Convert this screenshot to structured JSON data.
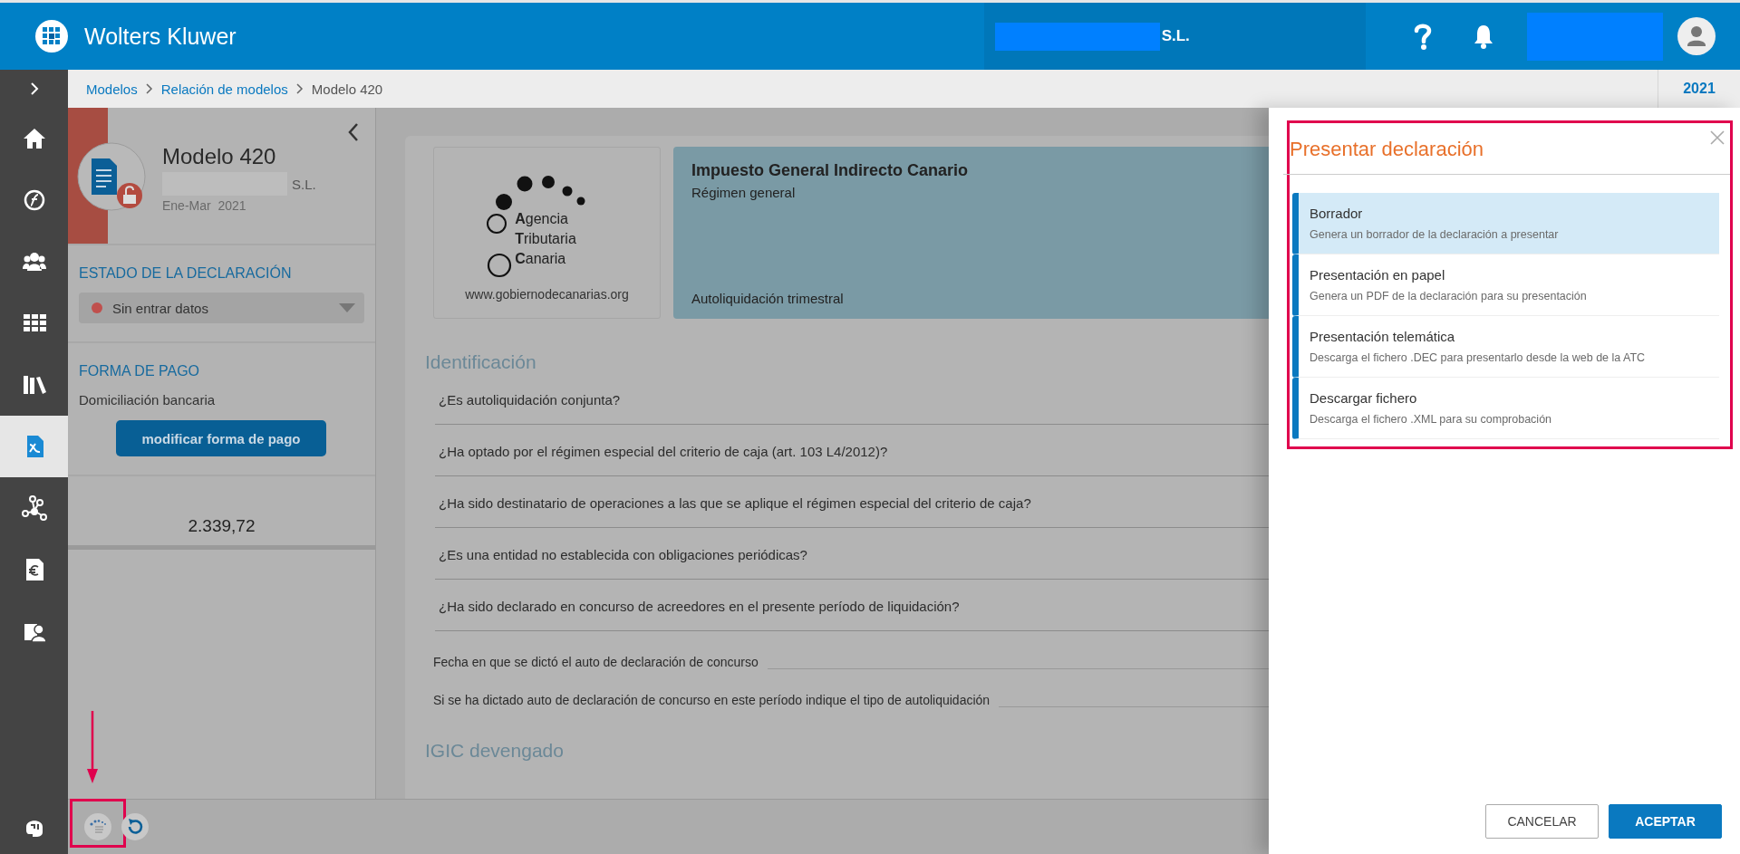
{
  "header": {
    "brand": "Wolters Kluwer",
    "company_suffix": "S.L."
  },
  "breadcrumbs": [
    {
      "label": "Modelos",
      "link": true
    },
    {
      "label": "Relación de modelos",
      "link": true
    },
    {
      "label": "Modelo 420",
      "link": false
    }
  ],
  "year": "2021",
  "nav": {
    "items": [
      {
        "kind": "home",
        "selected": false
      },
      {
        "kind": "formula",
        "selected": false
      },
      {
        "kind": "people",
        "selected": false
      },
      {
        "kind": "grid",
        "selected": false
      },
      {
        "kind": "books",
        "selected": false
      },
      {
        "kind": "document",
        "selected": true
      },
      {
        "kind": "network",
        "selected": false
      },
      {
        "kind": "euro",
        "selected": false
      },
      {
        "kind": "contact",
        "selected": false
      }
    ],
    "footer": {
      "kind": "support",
      "selected": false
    }
  },
  "model_panel": {
    "title": "Modelo 420",
    "company_suffix": "S.L.",
    "period": "Ene-Mar  2021",
    "status_heading": "ESTADO DE LA DECLARACIÓN",
    "status": {
      "label": "Sin entrar datos",
      "color": "#c0504d"
    },
    "payment_heading": "FORMA DE PAGO",
    "payment_method": "Domiciliación bancaria",
    "payment_button": "modificar forma de pago",
    "total": "2.339,72"
  },
  "summary": {
    "agency_lines": [
      "**A**gencia",
      "**T**ributaria",
      "**C**anaria"
    ],
    "agency_url": "www.gobiernodecanarias.org",
    "tax_title": "Impuesto General Indirecto Canario",
    "regime": "Régimen general",
    "period_type": "Autoliquidación trimestral"
  },
  "sections": [
    {
      "title": "Identificación",
      "questions": [
        "¿Es autoliquidación conjunta?",
        "¿Ha optado por el régimen especial del criterio de caja (art. 103 L4/2012)?",
        "¿Ha sido destinatario de operaciones a las que se aplique el régimen especial del criterio de caja?",
        "¿Es una entidad no establecida con obligaciones periódicas?",
        "¿Ha sido declarado en concurso de acreedores en el presente período de liquidación?"
      ],
      "fields": [
        {
          "label": "Fecha en que se dictó el auto de declaración de concurso"
        },
        {
          "label": "Si se ha dictado auto de declaración de concurso en este período indique el tipo de autoliquidación"
        }
      ]
    },
    {
      "title": "IGIC devengado"
    }
  ],
  "bottom_toolbar": [
    {
      "kind": "agency",
      "highlighted": true
    },
    {
      "kind": "refresh",
      "highlighted": false
    }
  ],
  "dialog": {
    "title": "Presentar declaración",
    "highlighted": true,
    "options": [
      {
        "title": "Borrador",
        "description": "Genera un borrador de la declaración a presentar",
        "selected": true
      },
      {
        "title": "Presentación en papel",
        "description": "Genera un PDF de la declaración para su presentación",
        "selected": false
      },
      {
        "title": "Presentación telemática",
        "description": "Descarga el fichero .DEC para presentarlo desde la web de la ATC",
        "selected": false
      },
      {
        "title": "Descargar fichero",
        "description": "Descarga el fichero .XML para su comprobación",
        "selected": false
      }
    ],
    "buttons": [
      {
        "label": "CANCELAR",
        "primary": false
      },
      {
        "label": "ACEPTAR",
        "primary": true
      }
    ]
  }
}
